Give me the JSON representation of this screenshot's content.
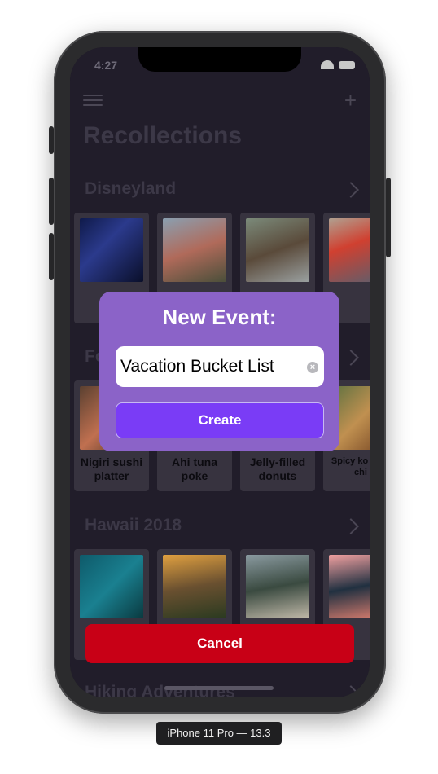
{
  "status_bar": {
    "time": "4:27"
  },
  "app": {
    "title": "Recollections",
    "sections": [
      {
        "name": "Disneyland",
        "cards": [
          {
            "caption": ""
          },
          {
            "caption": ""
          },
          {
            "caption": ""
          },
          {
            "caption": ""
          }
        ]
      },
      {
        "name": "Fo",
        "cards": [
          {
            "caption": "Nigiri sushi platter"
          },
          {
            "caption": "Ahi tuna poke"
          },
          {
            "caption": "Jelly-filled donuts"
          },
          {
            "caption": "Spicy ko fried chi"
          }
        ]
      },
      {
        "name": "Hawaii 2018",
        "cards": [
          {
            "caption": ""
          },
          {
            "caption": ""
          },
          {
            "caption": ""
          },
          {
            "caption": ""
          }
        ]
      },
      {
        "name": "Hiking Adventures"
      }
    ]
  },
  "modal": {
    "title": "New Event:",
    "input_value": "Vacation Bucket List",
    "create_label": "Create"
  },
  "cancel_label": "Cancel",
  "device_label": "iPhone 11 Pro — 13.3",
  "colors": {
    "modal_bg": "#8b63c8",
    "create_button": "#7a3cf6",
    "cancel_button": "#c80016"
  }
}
